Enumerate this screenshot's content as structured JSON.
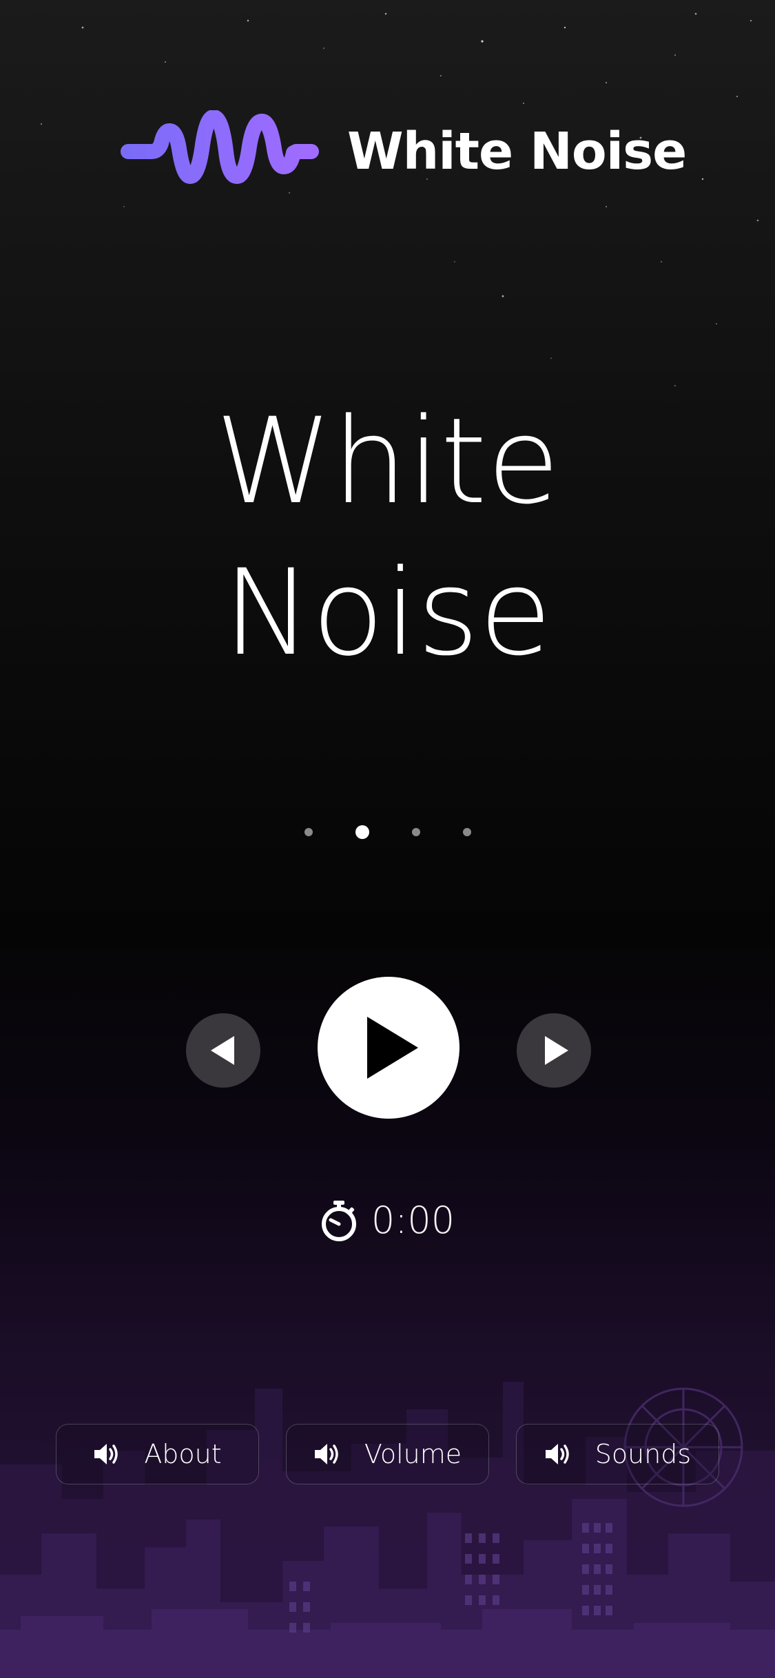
{
  "header": {
    "title": "White Noise",
    "logo_icon": "sound-wave-icon",
    "logo_color": "#8b6cff"
  },
  "main": {
    "title_line1": "White",
    "title_line2": "Noise"
  },
  "pager": {
    "count": 4,
    "active_index": 1
  },
  "controls": {
    "prev_icon": "triangle-left-icon",
    "play_icon": "play-icon",
    "next_icon": "triangle-right-icon"
  },
  "timer": {
    "icon": "stopwatch-icon",
    "value": "0:00"
  },
  "bottom_nav": [
    {
      "label": "About",
      "icon": "speaker-icon"
    },
    {
      "label": "Volume",
      "icon": "speaker-icon"
    },
    {
      "label": "Sounds",
      "icon": "speaker-icon"
    }
  ],
  "colors": {
    "accent": "#8b6cff",
    "background_top": "#1b1b1b",
    "background_bottom": "#2a1540"
  }
}
